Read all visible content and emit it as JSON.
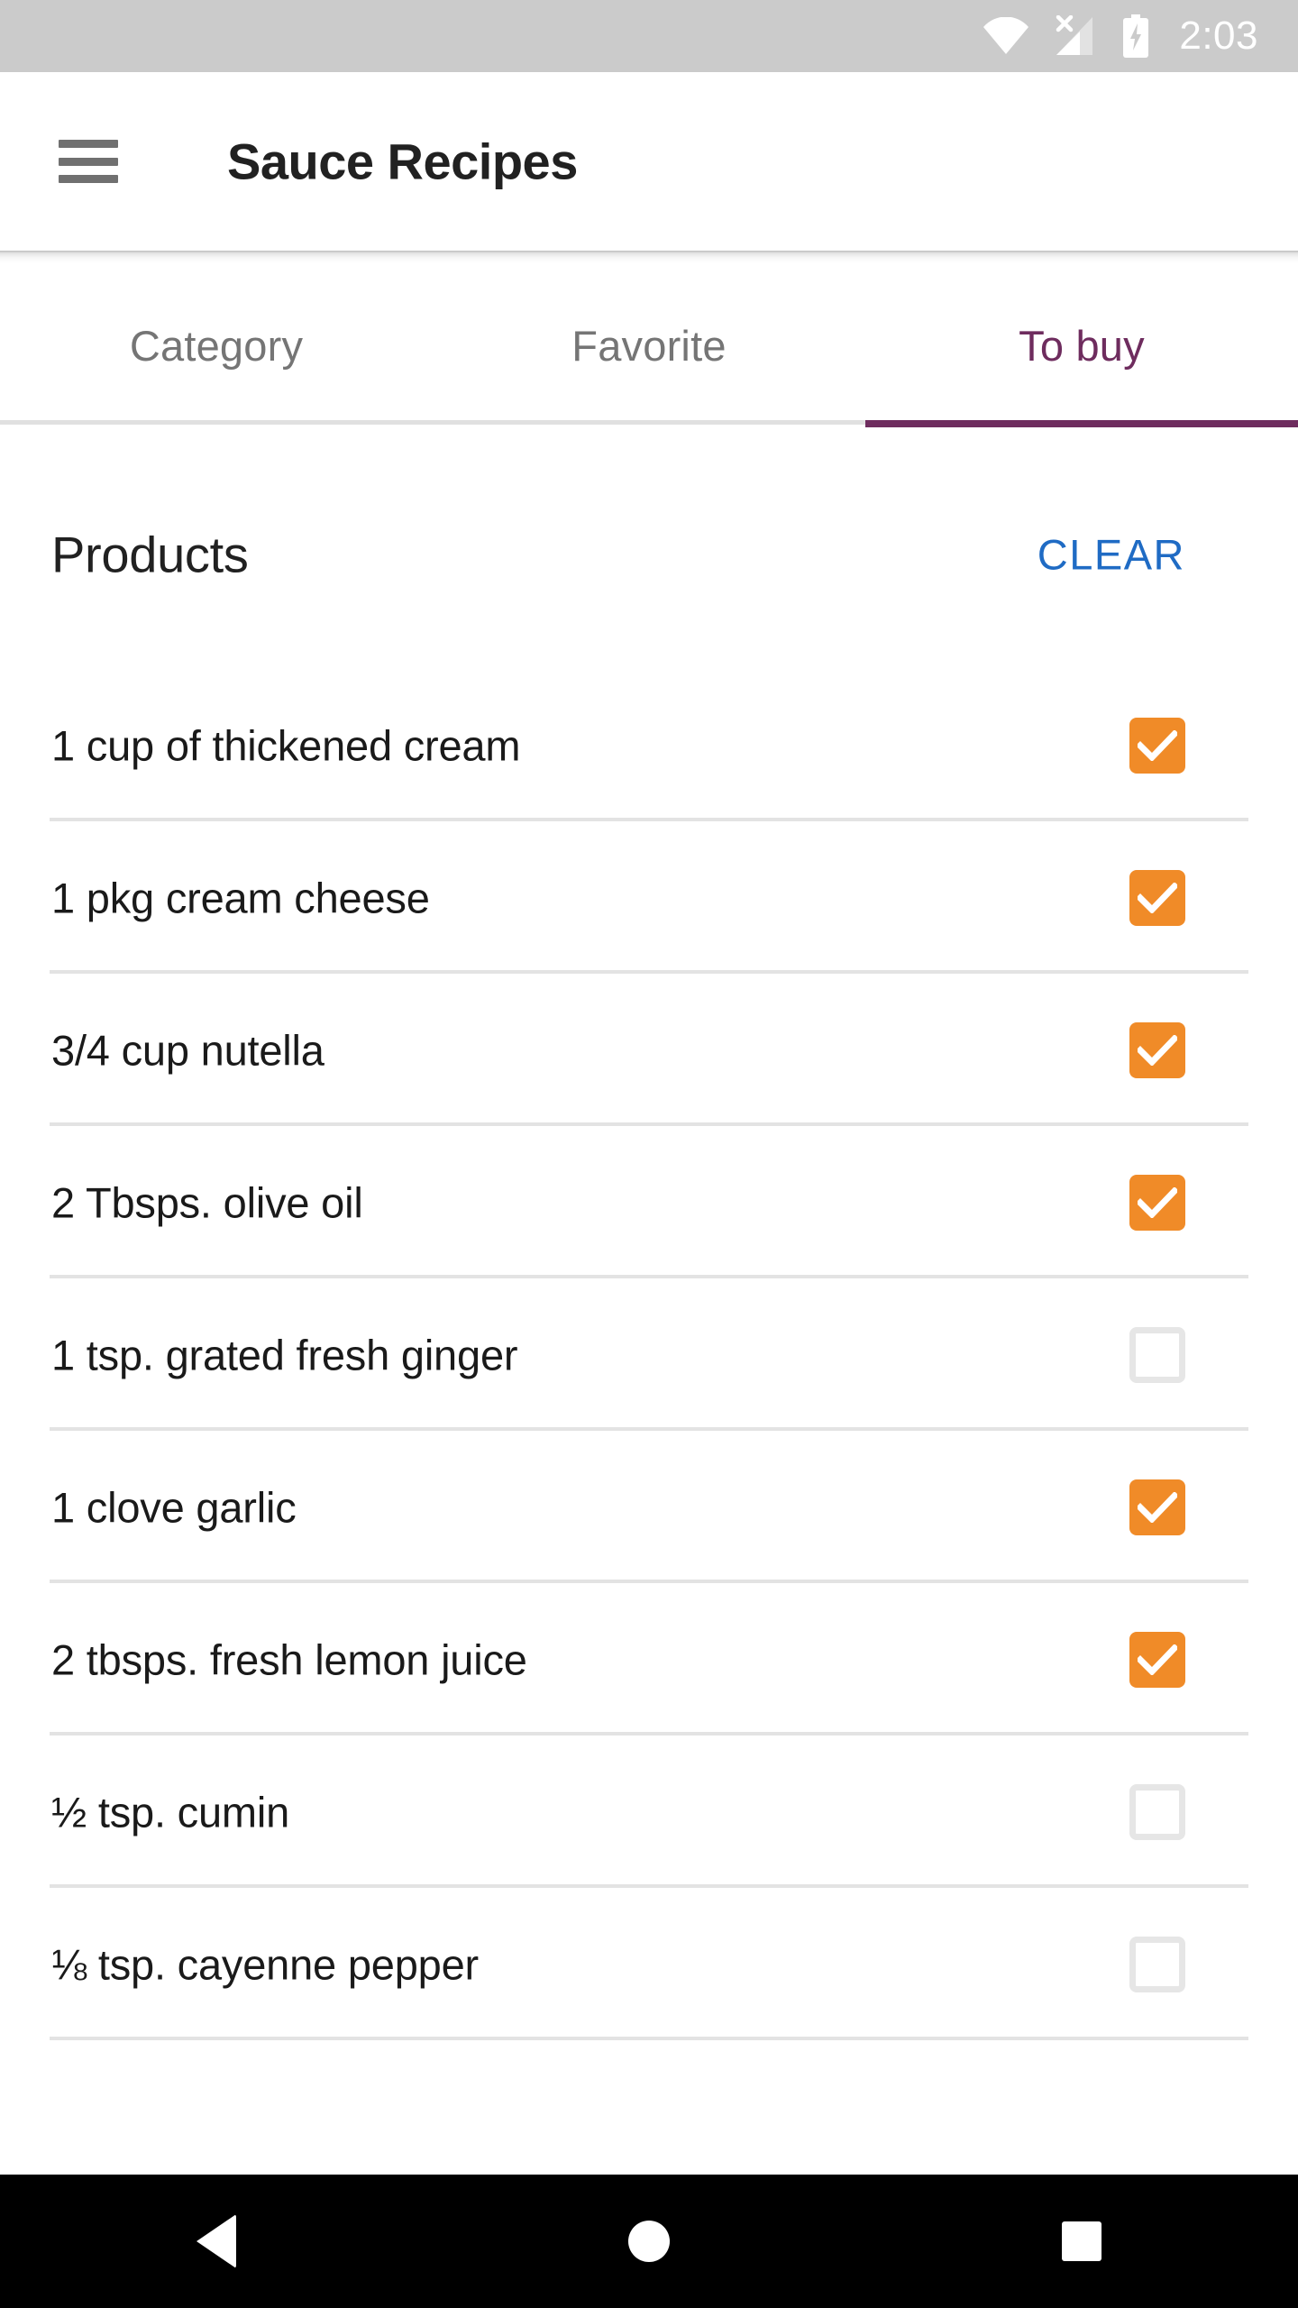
{
  "status_bar": {
    "time": "2:03",
    "icons": [
      "wifi-icon",
      "cellular-no-sim-icon",
      "battery-charging-icon"
    ],
    "background_color": "#cbcbcb",
    "icon_color": "#ffffff"
  },
  "app_bar": {
    "menu_icon": "hamburger-menu-icon",
    "title": "Sauce Recipes",
    "title_color": "#212121",
    "background_color": "#ffffff"
  },
  "tabs": {
    "items": [
      {
        "label": "Category",
        "active": false
      },
      {
        "label": "Favorite",
        "active": false
      },
      {
        "label": "To buy",
        "active": true
      }
    ],
    "active_color": "#6e2c5e",
    "inactive_color": "#757575"
  },
  "section": {
    "title": "Products",
    "clear_label": "CLEAR",
    "clear_color": "#1f6bc4"
  },
  "products": [
    {
      "label": "1 cup of thickened cream",
      "checked": true
    },
    {
      "label": "1 pkg cream cheese",
      "checked": true
    },
    {
      "label": "3/4 cup nutella",
      "checked": true
    },
    {
      "label": "2 Tbsps. olive oil",
      "checked": true
    },
    {
      "label": "1 tsp. grated fresh ginger",
      "checked": false
    },
    {
      "label": "1 clove garlic",
      "checked": true
    },
    {
      "label": "2 tbsps. fresh lemon juice",
      "checked": true
    },
    {
      "label": "½ tsp. cumin",
      "checked": false
    },
    {
      "label": "⅛ tsp. cayenne pepper",
      "checked": false
    }
  ],
  "checkbox_colors": {
    "checked_fill": "#f08b28",
    "checked_mark": "#ffffff",
    "unchecked_border": "#e6e6e6"
  },
  "nav_bar": {
    "buttons": [
      "back-button",
      "home-button",
      "recents-button"
    ],
    "background_color": "#000000",
    "icon_color": "#ffffff"
  }
}
